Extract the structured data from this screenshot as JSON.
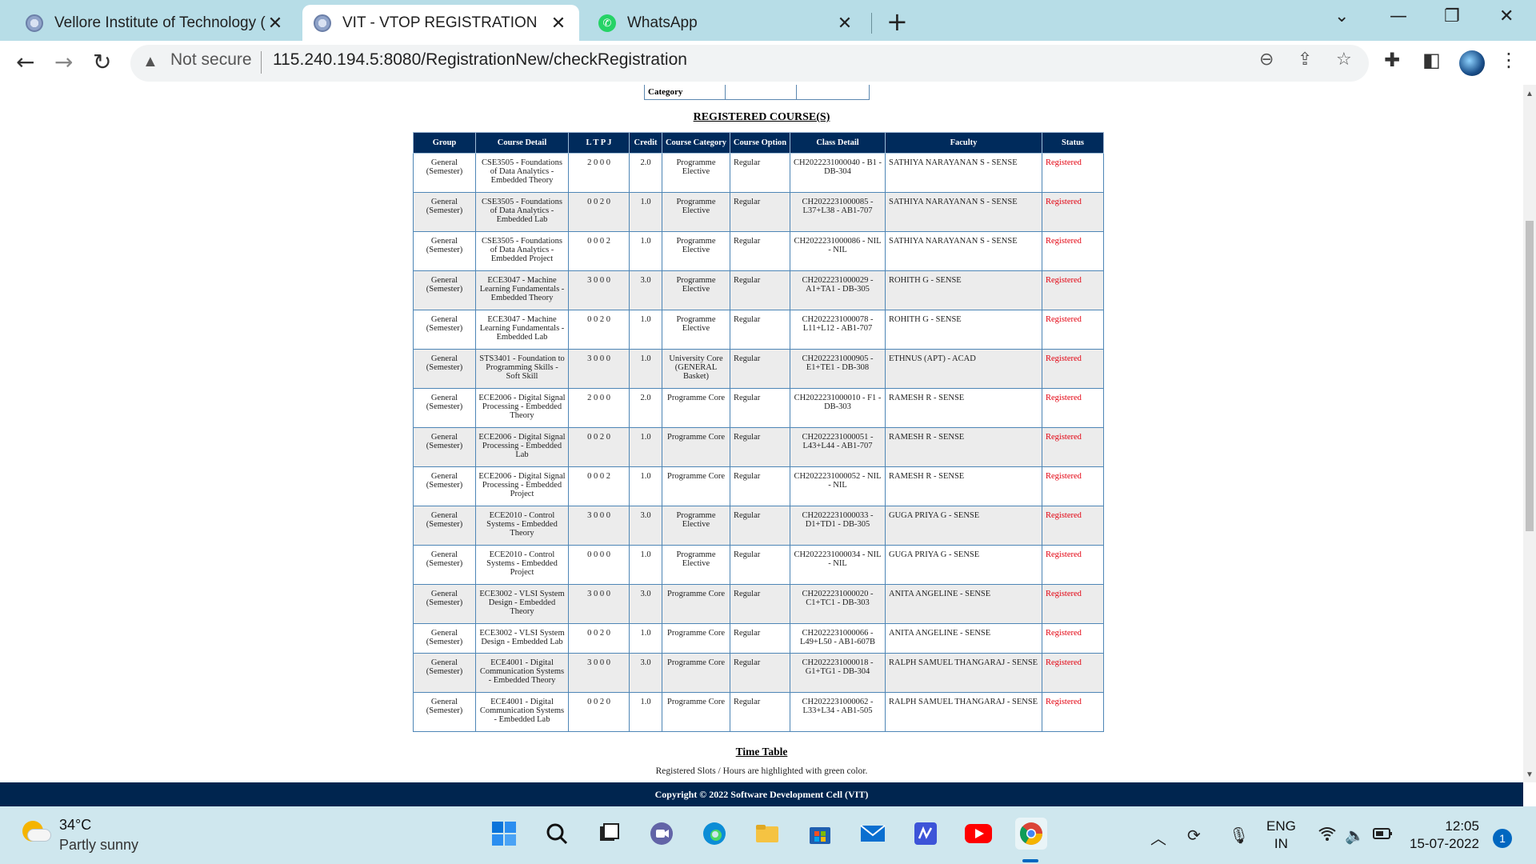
{
  "browser": {
    "tabs": [
      {
        "title": "Vellore Institute of Technology (V",
        "favicon": "vit-logo-icon",
        "active": false
      },
      {
        "title": "VIT - VTOP REGISTRATION",
        "favicon": "vit-logo-icon",
        "active": true
      },
      {
        "title": "WhatsApp",
        "favicon": "whatsapp-icon",
        "active": false
      }
    ],
    "security_label": "Not secure",
    "url": "115.240.194.5:8080/RegistrationNew/checkRegistration"
  },
  "page": {
    "category_label": "Category",
    "registered_title": "REGISTERED COURSE(S)",
    "columns": [
      "Group",
      "Course Detail",
      "L T P J",
      "Credit",
      "Course Category",
      "Course Option",
      "Class Detail",
      "Faculty",
      "Status"
    ],
    "rows": [
      {
        "group": "General (Semester)",
        "course": "CSE3505 - Foundations of Data Analytics - Embedded Theory",
        "ltpj": "2 0 0 0",
        "credit": "2.0",
        "category": "Programme Elective",
        "option": "Regular",
        "class": "CH2022231000040 - B1 - DB-304",
        "faculty": "SATHIYA NARAYANAN S - SENSE",
        "status": "Registered"
      },
      {
        "group": "General (Semester)",
        "course": "CSE3505 - Foundations of Data Analytics - Embedded Lab",
        "ltpj": "0 0 2 0",
        "credit": "1.0",
        "category": "Programme Elective",
        "option": "Regular",
        "class": "CH2022231000085 - L37+L38 - AB1-707",
        "faculty": "SATHIYA NARAYANAN S - SENSE",
        "status": "Registered"
      },
      {
        "group": "General (Semester)",
        "course": "CSE3505 - Foundations of Data Analytics - Embedded Project",
        "ltpj": "0 0 0 2",
        "credit": "1.0",
        "category": "Programme Elective",
        "option": "Regular",
        "class": "CH2022231000086 - NIL - NIL",
        "faculty": "SATHIYA NARAYANAN S - SENSE",
        "status": "Registered"
      },
      {
        "group": "General (Semester)",
        "course": "ECE3047 - Machine Learning Fundamentals - Embedded Theory",
        "ltpj": "3 0 0 0",
        "credit": "3.0",
        "category": "Programme Elective",
        "option": "Regular",
        "class": "CH2022231000029 - A1+TA1 - DB-305",
        "faculty": "ROHITH G - SENSE",
        "status": "Registered"
      },
      {
        "group": "General (Semester)",
        "course": "ECE3047 - Machine Learning Fundamentals - Embedded Lab",
        "ltpj": "0 0 2 0",
        "credit": "1.0",
        "category": "Programme Elective",
        "option": "Regular",
        "class": "CH2022231000078 - L11+L12 - AB1-707",
        "faculty": "ROHITH G - SENSE",
        "status": "Registered"
      },
      {
        "group": "General (Semester)",
        "course": "STS3401 - Foundation to Programming Skills - Soft Skill",
        "ltpj": "3 0 0 0",
        "credit": "1.0",
        "category": "University Core (GENERAL Basket)",
        "option": "Regular",
        "class": "CH2022231000905 - E1+TE1 - DB-308",
        "faculty": "ETHNUS (APT) - ACAD",
        "status": "Registered"
      },
      {
        "group": "General (Semester)",
        "course": "ECE2006 - Digital Signal Processing - Embedded Theory",
        "ltpj": "2 0 0 0",
        "credit": "2.0",
        "category": "Programme Core",
        "option": "Regular",
        "class": "CH2022231000010 - F1 - DB-303",
        "faculty": "RAMESH R - SENSE",
        "status": "Registered"
      },
      {
        "group": "General (Semester)",
        "course": "ECE2006 - Digital Signal Processing - Embedded Lab",
        "ltpj": "0 0 2 0",
        "credit": "1.0",
        "category": "Programme Core",
        "option": "Regular",
        "class": "CH2022231000051 - L43+L44 - AB1-707",
        "faculty": "RAMESH R - SENSE",
        "status": "Registered"
      },
      {
        "group": "General (Semester)",
        "course": "ECE2006 - Digital Signal Processing - Embedded Project",
        "ltpj": "0 0 0 2",
        "credit": "1.0",
        "category": "Programme Core",
        "option": "Regular",
        "class": "CH2022231000052 - NIL - NIL",
        "faculty": "RAMESH R - SENSE",
        "status": "Registered"
      },
      {
        "group": "General (Semester)",
        "course": "ECE2010 - Control Systems - Embedded Theory",
        "ltpj": "3 0 0 0",
        "credit": "3.0",
        "category": "Programme Elective",
        "option": "Regular",
        "class": "CH2022231000033 - D1+TD1 - DB-305",
        "faculty": "GUGA PRIYA G - SENSE",
        "status": "Registered"
      },
      {
        "group": "General (Semester)",
        "course": "ECE2010 - Control Systems - Embedded Project",
        "ltpj": "0 0 0 0",
        "credit": "1.0",
        "category": "Programme Elective",
        "option": "Regular",
        "class": "CH2022231000034 - NIL - NIL",
        "faculty": "GUGA PRIYA G - SENSE",
        "status": "Registered"
      },
      {
        "group": "General (Semester)",
        "course": "ECE3002 - VLSI System Design - Embedded Theory",
        "ltpj": "3 0 0 0",
        "credit": "3.0",
        "category": "Programme Core",
        "option": "Regular",
        "class": "CH2022231000020 - C1+TC1 - DB-303",
        "faculty": "ANITA ANGELINE - SENSE",
        "status": "Registered"
      },
      {
        "group": "General (Semester)",
        "course": "ECE3002 - VLSI System Design - Embedded Lab",
        "ltpj": "0 0 2 0",
        "credit": "1.0",
        "category": "Programme Core",
        "option": "Regular",
        "class": "CH2022231000066 - L49+L50 - AB1-607B",
        "faculty": "ANITA ANGELINE - SENSE",
        "status": "Registered"
      },
      {
        "group": "General (Semester)",
        "course": "ECE4001 - Digital Communication Systems - Embedded Theory",
        "ltpj": "3 0 0 0",
        "credit": "3.0",
        "category": "Programme Core",
        "option": "Regular",
        "class": "CH2022231000018 - G1+TG1 - DB-304",
        "faculty": "RALPH SAMUEL THANGARAJ - SENSE",
        "status": "Registered"
      },
      {
        "group": "General (Semester)",
        "course": "ECE4001 - Digital Communication Systems - Embedded Lab",
        "ltpj": "0 0 2 0",
        "credit": "1.0",
        "category": "Programme Core",
        "option": "Regular",
        "class": "CH2022231000062 - L33+L34 - AB1-505",
        "faculty": "RALPH SAMUEL THANGARAJ - SENSE",
        "status": "Registered"
      }
    ],
    "timetable_title": "Time Table",
    "timetable_note": "Registered Slots / Hours are highlighted with green color.",
    "footer": "Copyright © 2022 Software Development Cell (VIT)"
  },
  "taskbar": {
    "temperature": "34°C",
    "weather": "Partly sunny",
    "lang_line1": "ENG",
    "lang_line2": "IN",
    "time": "12:05",
    "date": "15-07-2022",
    "notifications": "1"
  },
  "colors": {
    "header_bg": "#002b5c",
    "status_text": "#e3000f",
    "tabbar_bg": "#b7dde7",
    "taskbar_bg": "#cfe7ee"
  }
}
